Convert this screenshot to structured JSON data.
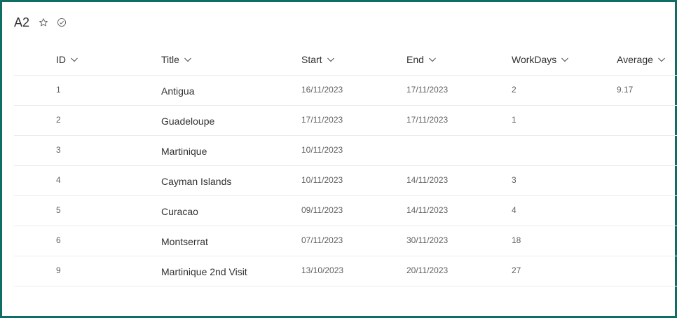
{
  "list": {
    "title": "A2"
  },
  "columns": [
    {
      "label": "ID"
    },
    {
      "label": "Title"
    },
    {
      "label": "Start"
    },
    {
      "label": "End"
    },
    {
      "label": "WorkDays"
    },
    {
      "label": "Average"
    }
  ],
  "rows": [
    {
      "id": "1",
      "title": "Antigua",
      "start": "16/11/2023",
      "end": "17/11/2023",
      "workdays": "2",
      "average": "9.17"
    },
    {
      "id": "2",
      "title": "Guadeloupe",
      "start": "17/11/2023",
      "end": "17/11/2023",
      "workdays": "1",
      "average": ""
    },
    {
      "id": "3",
      "title": "Martinique",
      "start": "10/11/2023",
      "end": "",
      "workdays": "",
      "average": ""
    },
    {
      "id": "4",
      "title": "Cayman Islands",
      "start": "10/11/2023",
      "end": "14/11/2023",
      "workdays": "3",
      "average": ""
    },
    {
      "id": "5",
      "title": "Curacao",
      "start": "09/11/2023",
      "end": "14/11/2023",
      "workdays": "4",
      "average": ""
    },
    {
      "id": "6",
      "title": "Montserrat",
      "start": "07/11/2023",
      "end": "30/11/2023",
      "workdays": "18",
      "average": ""
    },
    {
      "id": "9",
      "title": "Martinique 2nd Visit",
      "start": "13/10/2023",
      "end": "20/11/2023",
      "workdays": "27",
      "average": ""
    }
  ],
  "icons": {
    "favorite": "star-outline-icon",
    "status": "check-circle-icon",
    "sort": "chevron-down-icon"
  },
  "colors": {
    "frame": "#0f6e63"
  }
}
